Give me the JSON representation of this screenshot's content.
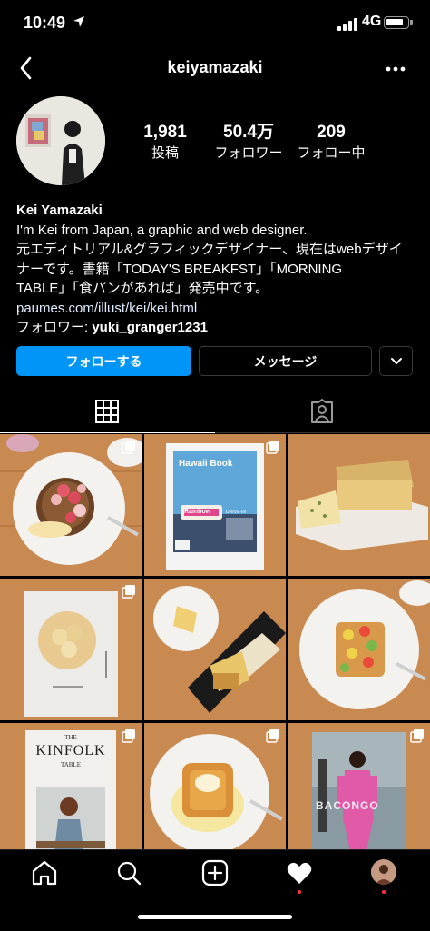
{
  "status_bar": {
    "time": "10:49",
    "network": "4G",
    "icons": [
      "location-arrow-icon",
      "signal-icon",
      "battery-icon"
    ]
  },
  "header": {
    "username": "keiyamazaki",
    "icons": [
      "back-chevron-icon",
      "more-icon"
    ]
  },
  "stats": [
    {
      "number": "1,981",
      "label": "投稿"
    },
    {
      "number": "50.4万",
      "label": "フォロワー"
    },
    {
      "number": "209",
      "label": "フォロー中"
    }
  ],
  "bio": {
    "name": "Kei Yamazaki",
    "lines": [
      "I'm Kei from Japan, a graphic and web designer.",
      "元エディトリアル&グラフィックデザイナー、現在はwebデザイ",
      "ナーです。書籍「TODAY'S BREAKFST」「MORNING",
      "TABLE」「食パンがあれば」発売中です。"
    ],
    "link": "paumes.com/illust/kei/kei.html",
    "followed_by_prefix": "フォロワー: ",
    "followed_by_user": "yuki_granger1231"
  },
  "buttons": {
    "follow": "フォローする",
    "message": "メッセージ"
  },
  "tabs": [
    "grid-icon",
    "tagged-icon"
  ],
  "grid_posts": [
    {
      "name": "pancakes-post",
      "multi": true
    },
    {
      "name": "hawaii-book-post",
      "multi": true,
      "cover_title": "Hawaii Book",
      "sign_text": "Rainbow",
      "sign_sub": "DRIVE-IN"
    },
    {
      "name": "pound-cake-post",
      "multi": false
    },
    {
      "name": "book-cover-post",
      "multi": true
    },
    {
      "name": "lemon-cake-post",
      "multi": false
    },
    {
      "name": "toast-post",
      "multi": false
    },
    {
      "name": "kinfolk-book-post",
      "multi": true,
      "cover_title": "KINFOLK",
      "cover_pre": "THE",
      "cover_sub": "TABLE"
    },
    {
      "name": "french-toast-post",
      "multi": true
    },
    {
      "name": "fashion-book-post",
      "multi": true,
      "cover_title": "BACONGO"
    }
  ],
  "bottom_nav": [
    "home-icon",
    "search-icon",
    "new-post-icon",
    "activity-heart-icon",
    "profile-avatar-icon"
  ],
  "colors": {
    "accent": "#0095f6",
    "background": "#000000",
    "notification": "#ff3040"
  }
}
